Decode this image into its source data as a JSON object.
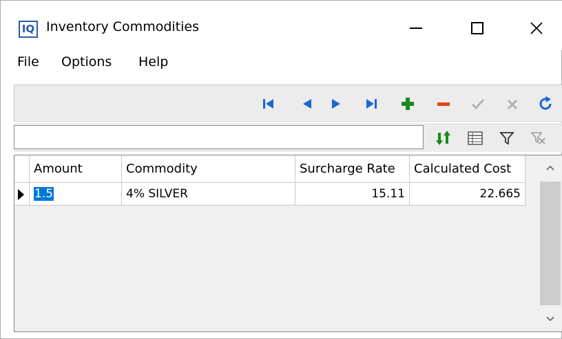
{
  "window": {
    "title": "Inventory Commodities",
    "icon_text": "IQ"
  },
  "menu": {
    "items": [
      "File",
      "Options",
      "Help"
    ]
  },
  "navigator": {
    "buttons": [
      "first-record",
      "prior-record",
      "next-record",
      "last-record",
      "insert",
      "delete",
      "post",
      "cancel",
      "refresh"
    ],
    "colors": {
      "nav_blue": "#1a66d6",
      "add_green": "#1a8a1a",
      "delete_red": "#e0441a",
      "disabled_gray": "#b0b0b0",
      "refresh_blue": "#1a66d6"
    }
  },
  "search": {
    "value": "",
    "placeholder": ""
  },
  "grid": {
    "columns": [
      "Amount",
      "Commodity",
      "Surcharge Rate",
      "Calculated Cost"
    ],
    "rows": [
      {
        "amount": "1.5",
        "commodity": "4% SILVER",
        "surcharge_rate": "15.11",
        "calculated_cost": "22.665"
      }
    ],
    "selection_color": "#0078d7"
  }
}
